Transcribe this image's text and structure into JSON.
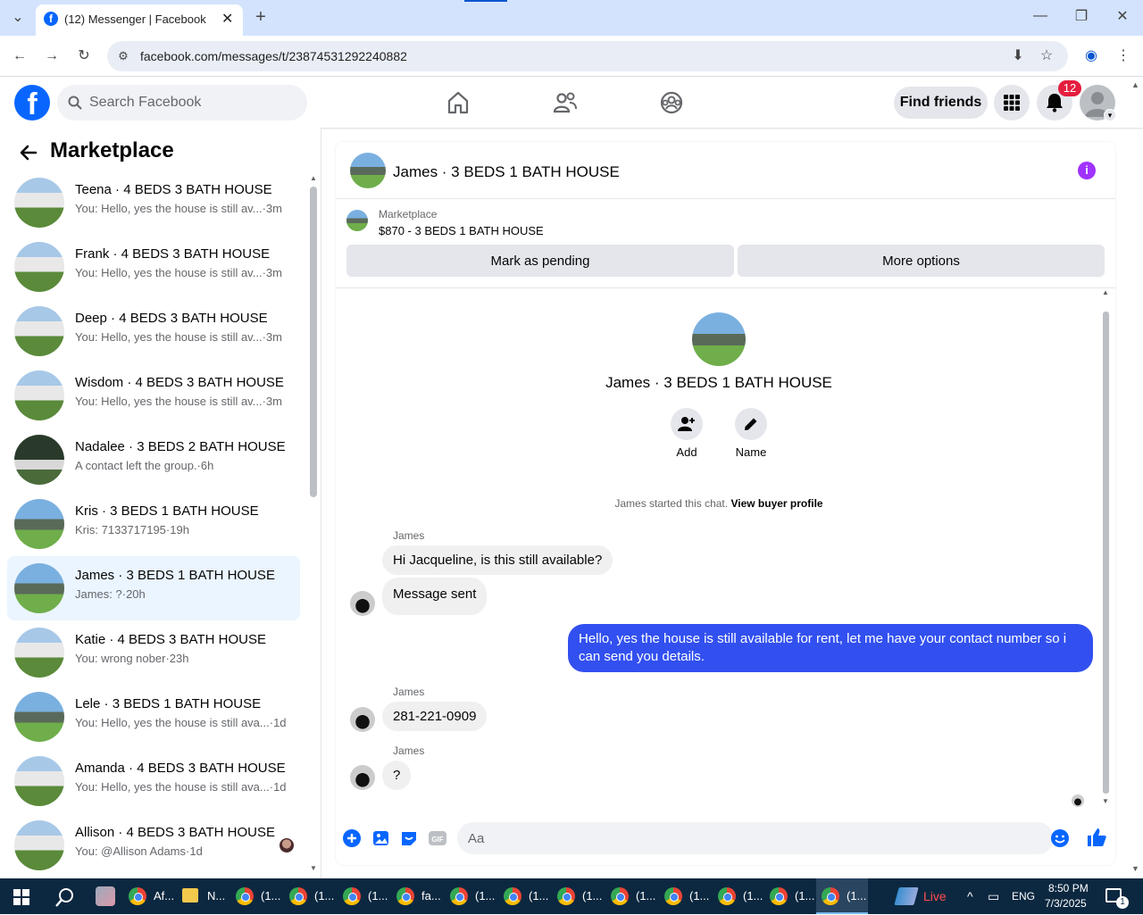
{
  "browser": {
    "tab_title": "(12) Messenger | Facebook",
    "url": "facebook.com/messages/t/23874531292240882"
  },
  "header": {
    "search_placeholder": "Search Facebook",
    "find_friends": "Find friends",
    "notifications_count": "12"
  },
  "sidebar": {
    "title": "Marketplace",
    "conversations": [
      {
        "name": "Teena · 4 BEDS 3 BATH HOUSE",
        "preview": "You: Hello, yes the house is still av...",
        "time": "·3m"
      },
      {
        "name": "Frank · 4 BEDS 3 BATH HOUSE",
        "preview": "You: Hello, yes the house is still av...",
        "time": "·3m"
      },
      {
        "name": "Deep · 4 BEDS 3 BATH HOUSE",
        "preview": "You: Hello, yes the house is still av...",
        "time": "·3m"
      },
      {
        "name": "Wisdom · 4 BEDS 3 BATH HOUSE",
        "preview": "You: Hello, yes the house is still av...",
        "time": "·3m"
      },
      {
        "name": "Nadalee · 3 BEDS 2 BATH HOUSE",
        "preview": "A contact left the group.",
        "time": "·6h"
      },
      {
        "name": "Kris · 3 BEDS 1 BATH HOUSE",
        "preview": "Kris: 7133717195",
        "time": "·19h"
      },
      {
        "name": "James · 3 BEDS 1 BATH HOUSE",
        "preview": "James: ?",
        "time": "·20h"
      },
      {
        "name": "Katie · 4 BEDS 3 BATH HOUSE",
        "preview": "You: wrong nober",
        "time": "·23h"
      },
      {
        "name": "Lele · 3 BEDS 1 BATH HOUSE",
        "preview": "You: Hello, yes the house is still ava...",
        "time": "·1d"
      },
      {
        "name": "Amanda · 4 BEDS 3 BATH HOUSE",
        "preview": "You: Hello, yes the house is still ava...",
        "time": "·1d"
      },
      {
        "name": "Allison · 4 BEDS 3 BATH HOUSE",
        "preview": "You: @Allison Adams",
        "time": "·1d"
      }
    ]
  },
  "chat": {
    "title": "James · 3 BEDS 1 BATH HOUSE",
    "marketplace_label": "Marketplace",
    "listing": "$870 - 3 BEDS 1 BATH HOUSE",
    "mark_pending": "Mark as pending",
    "more_options": "More options",
    "profile_name": "James · 3 BEDS 1 BATH HOUSE",
    "add_label": "Add",
    "name_label": "Name",
    "started_text": "James started this chat.",
    "view_buyer": "View buyer profile",
    "messages": [
      {
        "sender": "James",
        "text": "Hi Jacqueline, is this still available?"
      },
      {
        "text": "Message sent"
      },
      {
        "text": "Hello, yes the house is still available for rent, let me have your contact number so i can send you details."
      },
      {
        "sender": "James",
        "text": "281-221-0909"
      },
      {
        "sender": "James",
        "text": "?"
      }
    ],
    "composer_placeholder": "Aa"
  },
  "taskbar": {
    "items": [
      "Af...",
      "N...",
      "(1...",
      "(1...",
      "(1...",
      "fa...",
      "(1...",
      "(1...",
      "(1...",
      "(1...",
      "(1...",
      "(1...",
      "(1...",
      "(1..."
    ],
    "live": "Live",
    "lang": "ENG",
    "time": "8:50 PM",
    "date": "7/3/2025",
    "notif": "1"
  },
  "colors": {
    "fb_blue": "#0866ff",
    "outgoing_bubble": "#3250f0",
    "badge_red": "#e41e3f",
    "info_purple": "#a033ff"
  }
}
